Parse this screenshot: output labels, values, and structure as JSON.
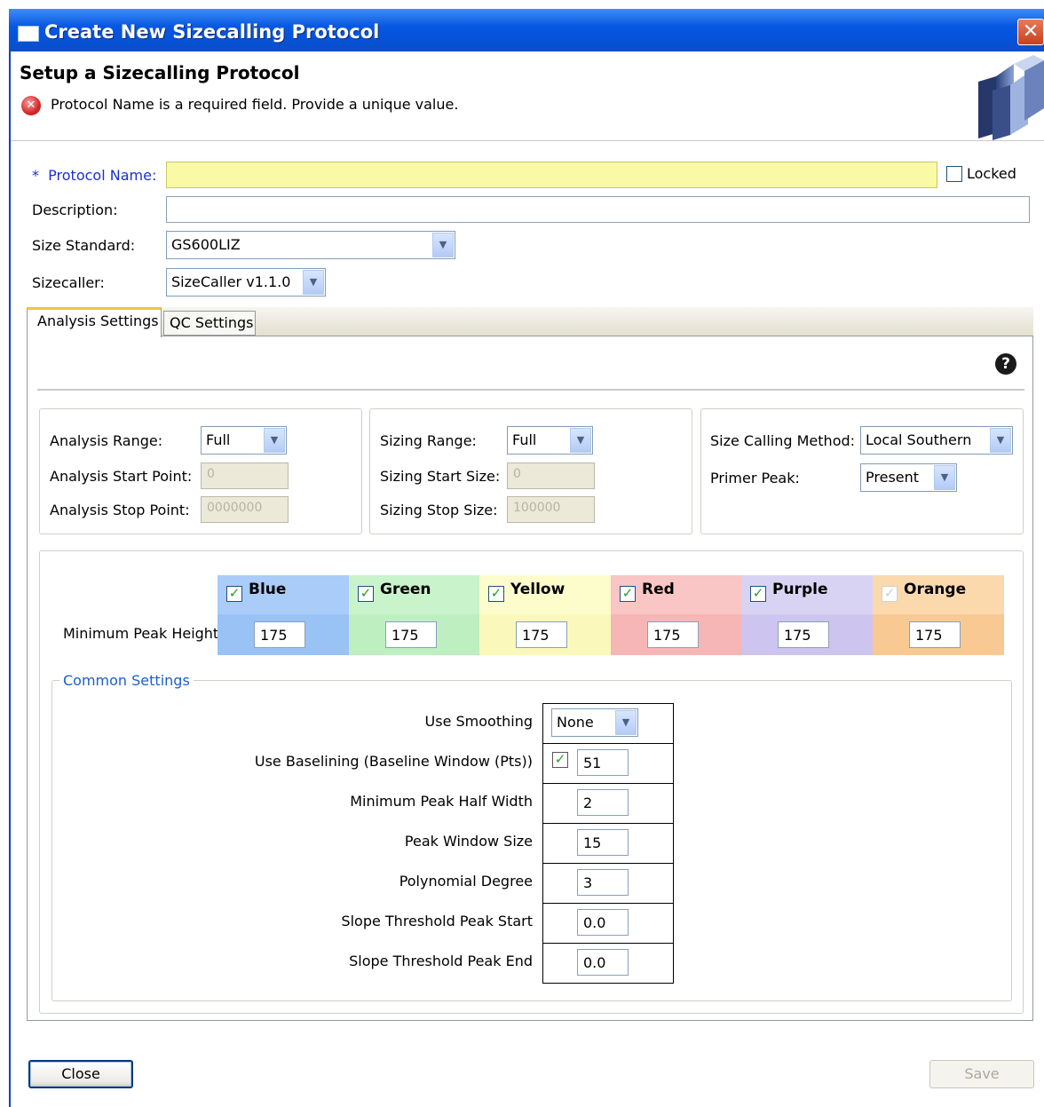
{
  "window": {
    "title": "Create New Sizecalling Protocol",
    "close_glyph": "✕"
  },
  "header": {
    "title": "Setup a Sizecalling Protocol",
    "error_message": "Protocol Name is a required field. Provide a unique value.",
    "error_icon": "error-icon"
  },
  "form": {
    "required_marker": "*",
    "protocol_name_label": "Protocol Name:",
    "protocol_name_value": "",
    "locked_label": "Locked",
    "locked_checked": false,
    "description_label": "Description:",
    "description_value": "",
    "size_standard_label": "Size Standard:",
    "size_standard_value": "GS600LIZ",
    "sizecaller_label": "Sizecaller:",
    "sizecaller_value": "SizeCaller v1.1.0"
  },
  "tabs": [
    {
      "label": "Analysis Settings",
      "active": true
    },
    {
      "label": "QC Settings",
      "active": false
    }
  ],
  "analysis": {
    "analysis_range_label": "Analysis Range:",
    "analysis_range_value": "Full",
    "analysis_start_label": "Analysis Start Point:",
    "analysis_start_value": "0",
    "analysis_stop_label": "Analysis Stop Point:",
    "analysis_stop_value": "0000000",
    "sizing_range_label": "Sizing Range:",
    "sizing_range_value": "Full",
    "sizing_start_label": "Sizing Start Size:",
    "sizing_start_value": "0",
    "sizing_stop_label": "Sizing Stop Size:",
    "sizing_stop_value": "100000",
    "size_calling_method_label": "Size Calling Method:",
    "size_calling_method_value": "Local Southern",
    "primer_peak_label": "Primer Peak:",
    "primer_peak_value": "Present"
  },
  "dyes": {
    "row_label": "Minimum Peak Height",
    "items": [
      {
        "name": "Blue",
        "value": "175",
        "checked": true,
        "enabled": true,
        "head_color": "#a9ccf9",
        "val_color": "#99c2f5"
      },
      {
        "name": "Green",
        "value": "175",
        "checked": true,
        "enabled": true,
        "head_color": "#c9f3cb",
        "val_color": "#bdefc0"
      },
      {
        "name": "Yellow",
        "value": "175",
        "checked": true,
        "enabled": true,
        "head_color": "#fdfccb",
        "val_color": "#fbf8bb"
      },
      {
        "name": "Red",
        "value": "175",
        "checked": true,
        "enabled": true,
        "head_color": "#f9c5c5",
        "val_color": "#f6b6b6"
      },
      {
        "name": "Purple",
        "value": "175",
        "checked": true,
        "enabled": true,
        "head_color": "#d9d3f3",
        "val_color": "#cdc5ef"
      },
      {
        "name": "Orange",
        "value": "175",
        "checked": true,
        "enabled": false,
        "head_color": "#fbd9ad",
        "val_color": "#f8c993"
      }
    ]
  },
  "common": {
    "legend": "Common Settings",
    "use_smoothing_label": "Use Smoothing",
    "use_smoothing_value": "None",
    "use_baselining_label": "Use Baselining (Baseline Window (Pts))",
    "use_baselining_checked": true,
    "baseline_window_value": "51",
    "min_peak_half_width_label": "Minimum Peak Half Width",
    "min_peak_half_width_value": "2",
    "peak_window_size_label": "Peak Window Size",
    "peak_window_size_value": "15",
    "polynomial_degree_label": "Polynomial Degree",
    "polynomial_degree_value": "3",
    "slope_threshold_start_label": "Slope Threshold Peak Start",
    "slope_threshold_start_value": "0.0",
    "slope_threshold_end_label": "Slope Threshold Peak End",
    "slope_threshold_end_value": "0.0"
  },
  "footer": {
    "close_label": "Close",
    "save_label": "Save"
  },
  "icons": {
    "checkmark": "✓",
    "dropdown": "▼",
    "help": "?",
    "error": "✕"
  }
}
